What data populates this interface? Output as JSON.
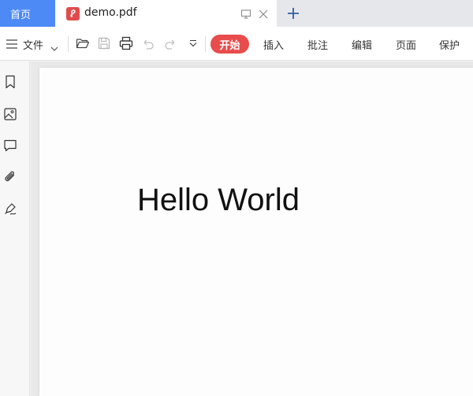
{
  "tabs": {
    "home_label": "首页",
    "document_title": "demo.pdf"
  },
  "toolbar": {
    "file_label": "文件",
    "start_label": "开始",
    "menu_tabs": [
      "插入",
      "批注",
      "编辑",
      "页面",
      "保护"
    ]
  },
  "document": {
    "text": "Hello World"
  },
  "colors": {
    "home_tab": "#4e8af5",
    "start_button": "#e84c4c",
    "pdf_icon": "#e14b4b"
  },
  "icons": {
    "sidebar": [
      "bookmark-icon",
      "image-icon",
      "comment-icon",
      "attachment-icon",
      "signature-icon"
    ],
    "toolbar": [
      "folder-open-icon",
      "save-icon",
      "print-icon",
      "undo-icon",
      "redo-icon",
      "more-icon"
    ]
  }
}
